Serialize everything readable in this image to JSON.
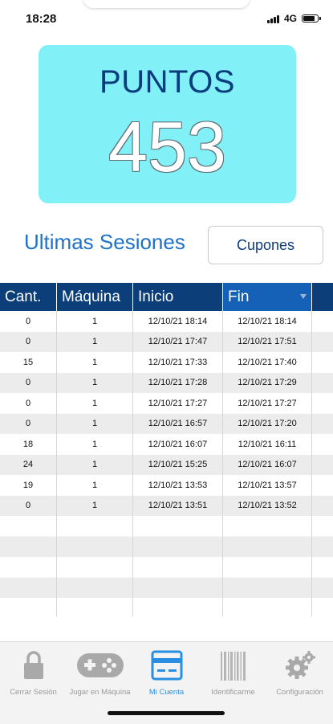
{
  "status_bar": {
    "time": "18:28",
    "network": "4G"
  },
  "points": {
    "title": "PUNTOS",
    "value": "453"
  },
  "sessions": {
    "heading": "Ultimas Sesiones",
    "coupons_button": "Cupones"
  },
  "table": {
    "columns": [
      "Cant.",
      "Máquina",
      "Inicio",
      "Fin"
    ],
    "sorted_column": "Fin",
    "rows": [
      {
        "qty": "0",
        "machine": "1",
        "start": "12/10/21 18:14",
        "end": "12/10/21 18:14"
      },
      {
        "qty": "0",
        "machine": "1",
        "start": "12/10/21 17:47",
        "end": "12/10/21 17:51"
      },
      {
        "qty": "15",
        "machine": "1",
        "start": "12/10/21 17:33",
        "end": "12/10/21 17:40"
      },
      {
        "qty": "0",
        "machine": "1",
        "start": "12/10/21 17:28",
        "end": "12/10/21 17:29"
      },
      {
        "qty": "0",
        "machine": "1",
        "start": "12/10/21 17:27",
        "end": "12/10/21 17:27"
      },
      {
        "qty": "0",
        "machine": "1",
        "start": "12/10/21 16:57",
        "end": "12/10/21 17:20"
      },
      {
        "qty": "18",
        "machine": "1",
        "start": "12/10/21 16:07",
        "end": "12/10/21 16:11"
      },
      {
        "qty": "24",
        "machine": "1",
        "start": "12/10/21 15:25",
        "end": "12/10/21 16:07"
      },
      {
        "qty": "19",
        "machine": "1",
        "start": "12/10/21 13:53",
        "end": "12/10/21 13:57"
      },
      {
        "qty": "0",
        "machine": "1",
        "start": "12/10/21 13:51",
        "end": "12/10/21 13:52"
      }
    ]
  },
  "tab_bar": {
    "active": "Mi Cuenta",
    "tabs": [
      {
        "label": "Cerrar Sesión",
        "icon": "lock-icon"
      },
      {
        "label": "Jugar en Máquina",
        "icon": "gamepad-icon"
      },
      {
        "label": "Mi Cuenta",
        "icon": "card-icon"
      },
      {
        "label": "Identificarme",
        "icon": "barcode-icon"
      },
      {
        "label": "Configuración",
        "icon": "gears-icon"
      }
    ]
  },
  "colors": {
    "points_bg": "#81f0f7",
    "title_blue": "#0b3c7d",
    "header_bg": "#0c3f7a",
    "sorted_header_bg": "#1661b8",
    "accent": "#2a8fe2"
  }
}
